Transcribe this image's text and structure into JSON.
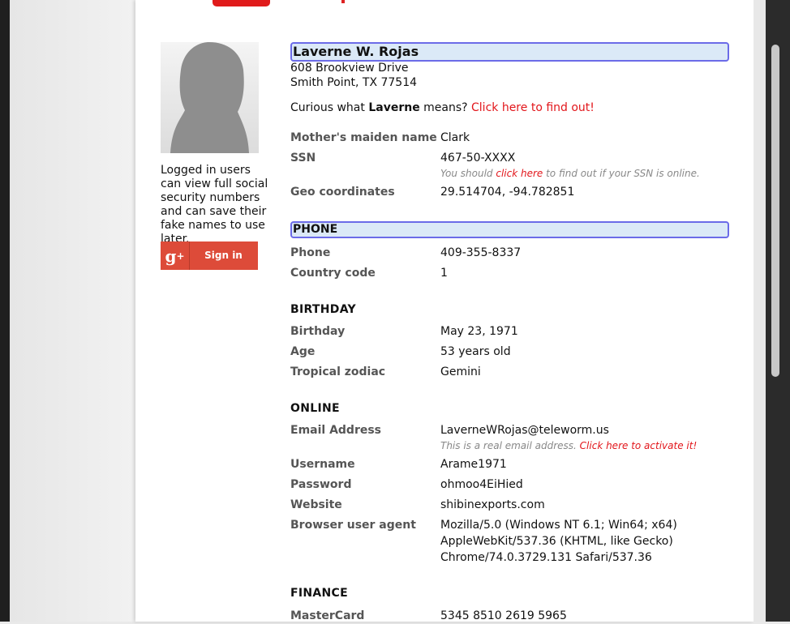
{
  "sidebar": {
    "login_note": "Logged in users can view full social security numbers and can save their fake names to use later.",
    "signin_label": "Sign in"
  },
  "identity": {
    "name": "Laverne W. Rojas",
    "address_line1": "608 Brookview Drive",
    "address_line2": "Smith Point, TX 77514",
    "curious_prefix": "Curious what ",
    "curious_name": "Laverne",
    "curious_suffix": " means? ",
    "curious_link": "Click here to find out!"
  },
  "details": {
    "maiden_label": "Mother's maiden name",
    "maiden_value": "Clark",
    "ssn_label": "SSN",
    "ssn_value": "467-50-XXXX",
    "ssn_note_prefix": "You should ",
    "ssn_note_link": "click here",
    "ssn_note_suffix": " to find out if your SSN is online.",
    "geo_label": "Geo coordinates",
    "geo_value": "29.514704, -94.782851"
  },
  "phone": {
    "section": "PHONE",
    "phone_label": "Phone",
    "phone_value": "409-355-8337",
    "cc_label": "Country code",
    "cc_value": "1"
  },
  "birthday": {
    "section": "BIRTHDAY",
    "birthday_label": "Birthday",
    "birthday_value": "May 23, 1971",
    "age_label": "Age",
    "age_value": "53 years old",
    "zodiac_label": "Tropical zodiac",
    "zodiac_value": "Gemini"
  },
  "online": {
    "section": "ONLINE",
    "email_label": "Email Address",
    "email_value": "LaverneWRojas@teleworm.us",
    "email_note": "This is a real email address. ",
    "email_note_link": "Click here to activate it!",
    "username_label": "Username",
    "username_value": "Arame1971",
    "password_label": "Password",
    "password_value": "ohmoo4EiHied",
    "website_label": "Website",
    "website_value": "shibinexports.com",
    "ua_label": "Browser user agent",
    "ua_line1": "Mozilla/5.0 (Windows NT 6.1; Win64; x64)",
    "ua_line2": "AppleWebKit/537.36 (KHTML, like Gecko)",
    "ua_line3": "Chrome/74.0.3729.131 Safari/537.36"
  },
  "finance": {
    "section": "FINANCE",
    "card_label": "MasterCard",
    "card_value": "5345 8510 2619 5965"
  },
  "icons": {
    "google_plus": "google-plus-icon",
    "avatar": "avatar-silhouette"
  }
}
